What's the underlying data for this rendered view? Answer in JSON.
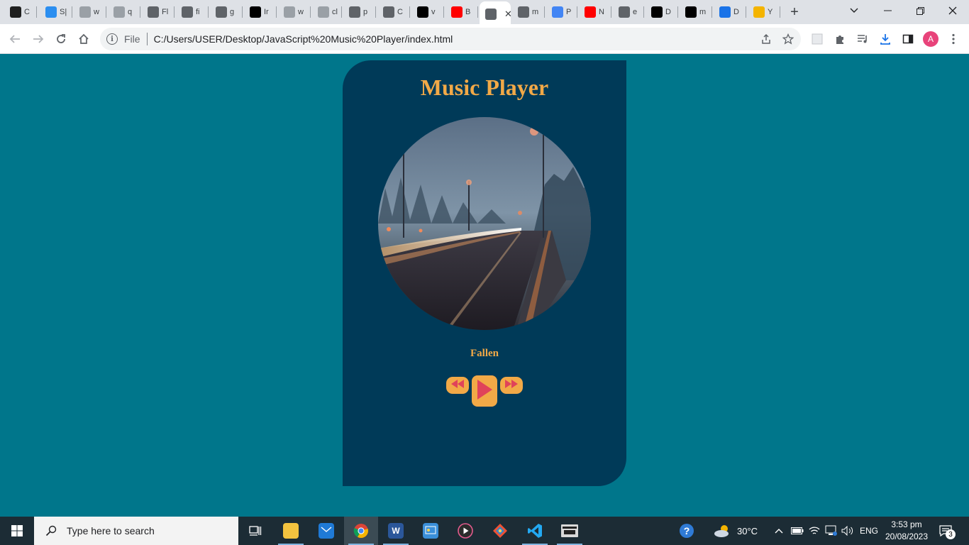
{
  "browser": {
    "tabs": [
      {
        "label": "C",
        "icon": "coursera-icon",
        "color": "#1f1f1f"
      },
      {
        "label": "S|",
        "icon": "pen-icon",
        "color": "#2b8ef0"
      },
      {
        "label": "w",
        "icon": "mountain-icon",
        "color": "#9aa0a6"
      },
      {
        "label": "q",
        "icon": "spiral-icon",
        "color": "#9aa0a6"
      },
      {
        "label": "Fl",
        "icon": "globe-icon",
        "color": "#5f6368"
      },
      {
        "label": "fi",
        "icon": "globe-icon",
        "color": "#5f6368"
      },
      {
        "label": "g",
        "icon": "globe-icon",
        "color": "#5f6368"
      },
      {
        "label": "Ir",
        "icon": "leaf-icon",
        "color": "#000000"
      },
      {
        "label": "w",
        "icon": "google-icon",
        "color": "#9aa0a6"
      },
      {
        "label": "cl",
        "icon": "chatgpt-icon",
        "color": "#9aa0a6"
      },
      {
        "label": "p",
        "icon": "chatgpt-icon",
        "color": "#5f6368"
      },
      {
        "label": "C",
        "icon": "globe-icon",
        "color": "#5f6368"
      },
      {
        "label": "v",
        "icon": "github-icon",
        "color": "#000000"
      },
      {
        "label": "B",
        "icon": "youtube-icon",
        "color": "#ff0000"
      },
      {
        "label": "",
        "icon": "globe-icon",
        "color": "#5f6368",
        "active": true
      },
      {
        "label": "m",
        "icon": "globe-icon",
        "color": "#5f6368"
      },
      {
        "label": "P",
        "icon": "docs-icon",
        "color": "#4285f4"
      },
      {
        "label": "N",
        "icon": "youtube-icon",
        "color": "#ff0000"
      },
      {
        "label": "e",
        "icon": "globe-icon",
        "color": "#5f6368"
      },
      {
        "label": "D",
        "icon": "github-icon",
        "color": "#000000"
      },
      {
        "label": "m",
        "icon": "github-icon",
        "color": "#000000"
      },
      {
        "label": "D",
        "icon": "download-icon",
        "color": "#1a73e8"
      },
      {
        "label": "Y",
        "icon": "emoji-icon",
        "color": "#f4b400"
      }
    ],
    "address": {
      "scheme_label": "File",
      "url": "C:/Users/USER/Desktop/JavaScript%20Music%20Player/index.html"
    },
    "profile_initial": "A"
  },
  "app": {
    "title": "Music Player",
    "song_title": "Fallen",
    "colors": {
      "page_bg": "#00768b",
      "card_bg": "#003a58",
      "accent": "#f2a947",
      "control_glyph": "#e0435a"
    }
  },
  "taskbar": {
    "search_placeholder": "Type here to search",
    "weather": "30°C",
    "language": "ENG",
    "time": "3:53 pm",
    "date": "20/08/2023",
    "notification_count": "3"
  }
}
